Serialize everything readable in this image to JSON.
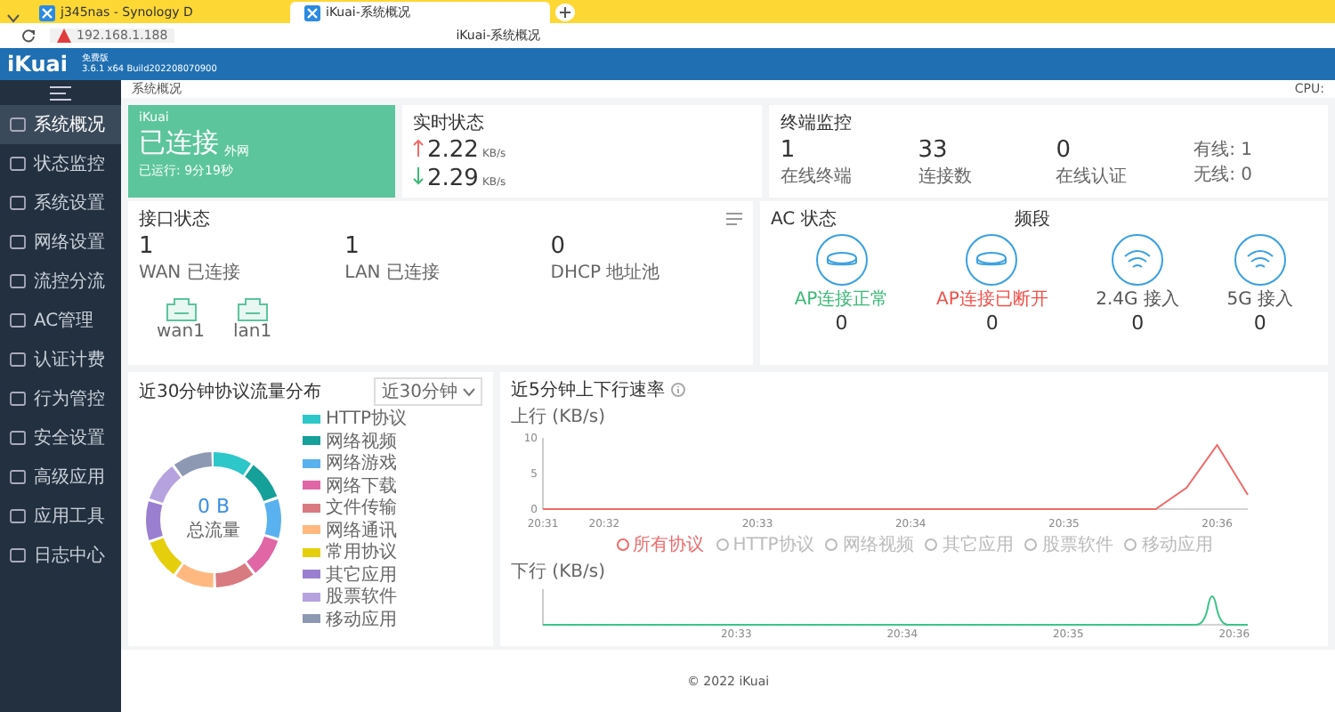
{
  "browser": {
    "tabs": [
      {
        "label": "j345nas - Synology D",
        "selected": false
      },
      {
        "label": "iKuai-系统概况",
        "selected": true
      }
    ],
    "address": "192.168.1.188",
    "page_title": "iKuai-系统概况"
  },
  "header": {
    "logo": "iKuai",
    "edition": "免费版",
    "version": "3.6.1 x64 Build202208070900"
  },
  "sidebar": {
    "items": [
      {
        "label": "系统概况",
        "selected": true
      },
      {
        "label": "状态监控",
        "selected": false
      },
      {
        "label": "系统设置",
        "selected": false
      },
      {
        "label": "网络设置",
        "selected": false
      },
      {
        "label": "流控分流",
        "selected": false
      },
      {
        "label": "AC管理",
        "selected": false
      },
      {
        "label": "认证计费",
        "selected": false
      },
      {
        "label": "行为管控",
        "selected": false
      },
      {
        "label": "安全设置",
        "selected": false
      },
      {
        "label": "高级应用",
        "selected": false
      },
      {
        "label": "应用工具",
        "selected": false
      },
      {
        "label": "日志中心",
        "selected": false
      }
    ]
  },
  "breadcrumb": "系统概况",
  "cpu_label": "CPU:",
  "status_card": {
    "title": "iKuai",
    "status": "已连接",
    "suffix": "外网",
    "uptime": "已运行: 9分19秒"
  },
  "speed_card": {
    "title": "实时状态",
    "up": "2.22",
    "up_unit": "KB/s",
    "down": "2.29",
    "down_unit": "KB/s"
  },
  "terminal_card": {
    "title": "终端监控",
    "stats": [
      {
        "value": "1",
        "label": "在线终端"
      },
      {
        "value": "33",
        "label": "连接数"
      },
      {
        "value": "0",
        "label": "在线认证"
      }
    ],
    "wired": "有线: 1",
    "wireless": "无线: 0"
  },
  "interface_card": {
    "title": "接口状态",
    "stats": [
      {
        "value": "1",
        "label": "WAN 已连接"
      },
      {
        "value": "1",
        "label": "LAN 已连接"
      },
      {
        "value": "0",
        "label": "DHCP 地址池"
      }
    ],
    "ports": [
      "wan1",
      "lan1"
    ]
  },
  "ac_card": {
    "title": "AC 状态",
    "band_title": "频段",
    "items": [
      {
        "kind": "ap",
        "label": "AP连接正常",
        "color": "#3cb878",
        "value": "0"
      },
      {
        "kind": "ap",
        "label": "AP连接已断开",
        "color": "#f0504a",
        "value": "0"
      },
      {
        "kind": "wifi",
        "label": "2.4G 接入",
        "color": "#555555",
        "value": "0"
      },
      {
        "kind": "wifi",
        "label": "5G 接入",
        "color": "#555555",
        "value": "0"
      }
    ]
  },
  "protocol_card": {
    "title": "近30分钟协议流量分布",
    "range": "近30分钟",
    "total": "0 B",
    "total_label": "总流量",
    "legend": [
      {
        "label": "HTTP协议",
        "color": "#2ec7c9"
      },
      {
        "label": "网络视频",
        "color": "#16a09a"
      },
      {
        "label": "网络游戏",
        "color": "#5ab1ef"
      },
      {
        "label": "网络下载",
        "color": "#e066a6"
      },
      {
        "label": "文件传输",
        "color": "#d87a80"
      },
      {
        "label": "网络通讯",
        "color": "#ffb980"
      },
      {
        "label": "常用协议",
        "color": "#e5cf0d"
      },
      {
        "label": "其它应用",
        "color": "#9a7fd1"
      },
      {
        "label": "股票软件",
        "color": "#b6a2de"
      },
      {
        "label": "移动应用",
        "color": "#8d98b3"
      }
    ]
  },
  "rate_card": {
    "title": "近5分钟上下行速率",
    "up_chart": {
      "chart_data": {
        "type": "line",
        "ylabel": "上行 (KB/s)",
        "categories": [
          "20:31",
          null,
          "20:32",
          null,
          null,
          null,
          null,
          "20:33",
          null,
          null,
          null,
          null,
          "20:34",
          null,
          null,
          null,
          null,
          "20:35",
          null,
          null,
          null,
          null,
          "20:36",
          null
        ],
        "series": [
          {
            "name": "所有协议",
            "color": "#f06a6a",
            "values": [
              0,
              0,
              0,
              0,
              0,
              0,
              0,
              0,
              0,
              0,
              0,
              0,
              0,
              0,
              0,
              0,
              0,
              0,
              0,
              0,
              0,
              3,
              9,
              2
            ]
          }
        ],
        "ylim": [
          0,
          10
        ],
        "yticks": [
          0,
          5,
          10
        ]
      }
    },
    "legend": [
      {
        "label": "HTTP协议",
        "selected": false
      },
      {
        "label": "网络视频",
        "selected": false
      },
      {
        "label": "其它应用",
        "selected": false
      },
      {
        "label": "股票软件",
        "selected": false
      },
      {
        "label": "移动应用",
        "selected": false
      }
    ],
    "down_chart": {
      "ylabel": "下行 (KB/s)",
      "x_labels": [
        "20:33",
        "20:34",
        "20:35",
        "20:36"
      ]
    }
  },
  "footer": "© 2022 iKuai"
}
